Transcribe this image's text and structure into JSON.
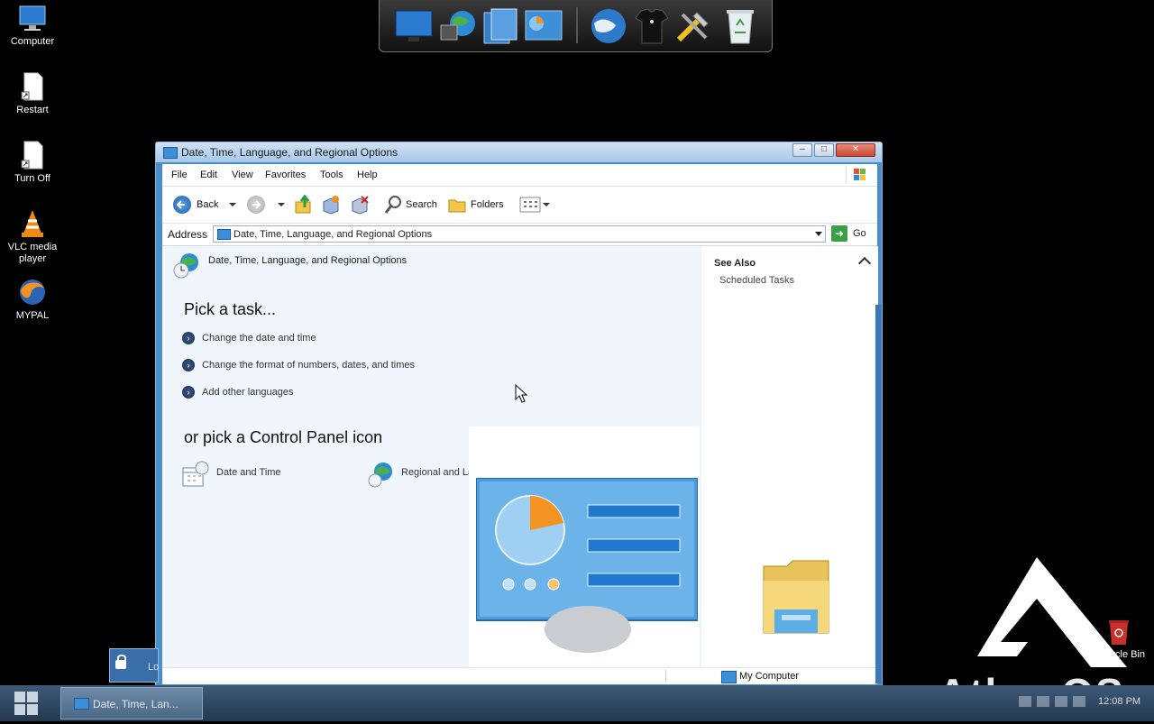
{
  "desktop": {
    "icons": [
      {
        "label": "Computer"
      },
      {
        "label": "Restart"
      },
      {
        "label": "Turn Off"
      },
      {
        "label": "VLC media player"
      },
      {
        "label": "MYPAL"
      }
    ],
    "recycle_bin_label": "Recycle Bin"
  },
  "window": {
    "title": "Date, Time, Language, and Regional Options",
    "menu": [
      "File",
      "Edit",
      "View",
      "Favorites",
      "Tools",
      "Help"
    ],
    "toolbar": {
      "back": "Back",
      "search": "Search",
      "folders": "Folders"
    },
    "address": {
      "label": "Address",
      "value": "Date, Time, Language, and Regional Options",
      "go": "Go"
    },
    "page_heading": "Date, Time, Language, and Regional Options",
    "pick_task_heading": "Pick a task...",
    "tasks": [
      "Change the date and time",
      "Change the format of numbers, dates, and times",
      "Add other languages"
    ],
    "pick_icon_heading": "or pick a Control Panel icon",
    "cp_icons": [
      "Date and Time",
      "Regional and Language Options"
    ],
    "see_also": {
      "title": "See Also",
      "links": [
        "Scheduled Tasks"
      ]
    },
    "status": {
      "zone": "My Computer"
    }
  },
  "taskbar": {
    "active_task": "Date, Time, Lan...",
    "clock": "12:08 PM",
    "lock_label": "Lo"
  },
  "branding": {
    "logo_text": "Atlas OS"
  }
}
